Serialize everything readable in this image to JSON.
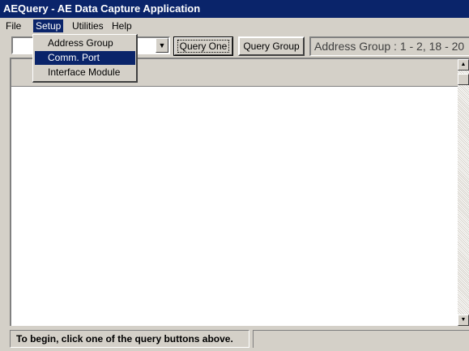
{
  "window": {
    "title": "AEQuery  - AE Data Capture Application"
  },
  "menubar": {
    "items": [
      {
        "label": "File"
      },
      {
        "label": "Setup",
        "active": true
      },
      {
        "label": "Utilities"
      },
      {
        "label": "Help"
      }
    ]
  },
  "setup_menu": {
    "items": [
      {
        "label": "Address Group"
      },
      {
        "label": "Comm. Port",
        "highlighted": true
      },
      {
        "label": "Interface Module"
      }
    ]
  },
  "toolbar": {
    "combo_value": "",
    "query_one_label": "Query One",
    "query_group_label": "Query Group",
    "address_group_display": "Address Group : 1 - 2, 18 - 20"
  },
  "statusbar": {
    "message": "To begin, click one of the query buttons above."
  },
  "colors": {
    "title_bar": "#0a246a",
    "face": "#d4d0c8",
    "highlight": "#0a246a"
  }
}
